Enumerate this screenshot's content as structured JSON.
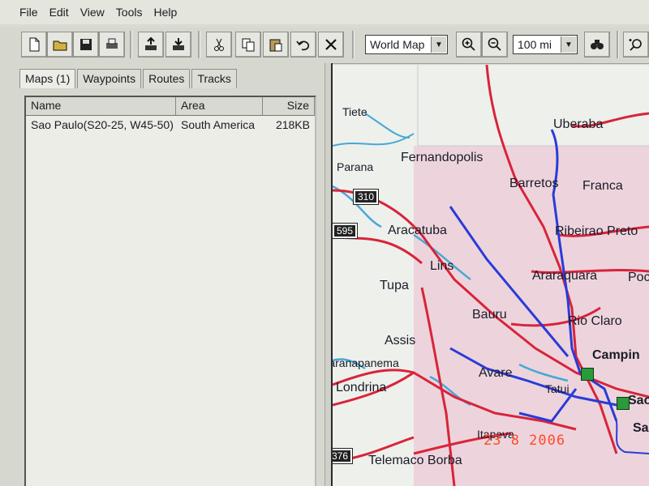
{
  "menu": [
    "File",
    "Edit",
    "View",
    "Tools",
    "Help"
  ],
  "toolbar": {
    "buttons": [
      "new-icon",
      "open-icon",
      "save-icon",
      "print-icon",
      "send-to-device-icon",
      "receive-from-device-icon",
      "cut-icon",
      "copy-icon",
      "paste-icon",
      "undo-icon",
      "delete-icon",
      "zoom-in-icon",
      "zoom-out-icon",
      "find-icon",
      "zoom-tool-icon"
    ],
    "map_select": "World Map",
    "scale_select": "100 mi"
  },
  "tabs": [
    "Maps (1)",
    "Waypoints",
    "Routes",
    "Tracks"
  ],
  "maps_table": {
    "columns": [
      "Name",
      "Area",
      "Size"
    ],
    "rows": [
      {
        "name": "Sao Paulo(S20-25, W45-50)",
        "area": "South America",
        "size": "218KB"
      }
    ]
  },
  "map": {
    "cities": [
      "Tiete",
      "Uberaba",
      "Fernandopolis",
      "Parana",
      "Barretos",
      "Franca",
      "Aracatuba",
      "Ribeirao Preto",
      "Lins",
      "Araraquara",
      "Tupa",
      "Bauru",
      "Rio Claro",
      "Assis",
      "Campin",
      "Paranapanema",
      "Avare",
      "Londrina",
      "Tatui",
      "Itapeva",
      "Telemaco Borba",
      "Sao",
      "Sa",
      "Poc"
    ],
    "highways": [
      "310",
      "595",
      "376"
    ]
  },
  "camera_datestamp": "23  8 2006",
  "colors": {
    "road_red": "#d8243a",
    "road_blue": "#2a3bd8",
    "water": "#46a8d6",
    "region_pink": "#edd4dc"
  }
}
